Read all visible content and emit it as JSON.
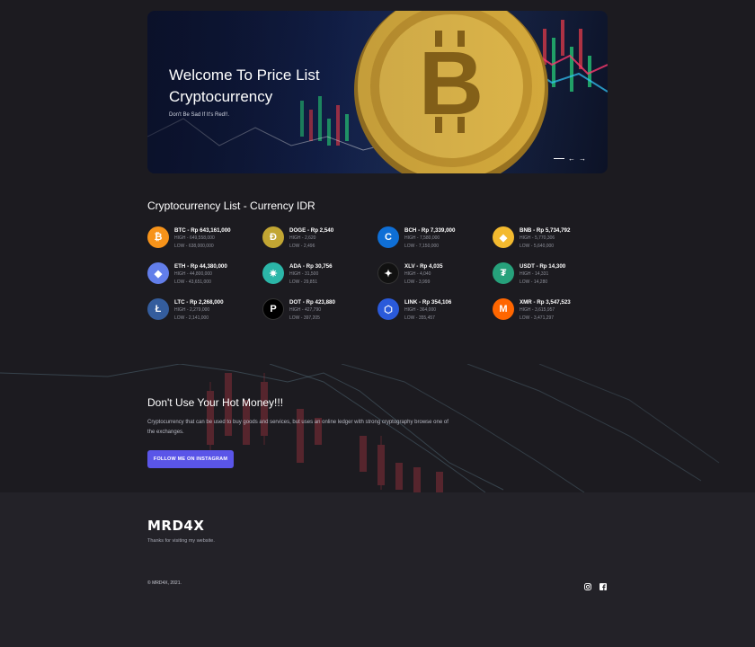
{
  "hero": {
    "title_line1": "Welcome To Price List",
    "title_line2": "Cryptocurrency",
    "subtitle": "Don't Be Sad If It's Red!!.",
    "nav_prev": "←",
    "nav_next": "→"
  },
  "list": {
    "title": "Cryptocurrency List - Currency IDR",
    "coins": [
      {
        "name": "BTC - Rp 643,161,000",
        "high": "HIGH - 649,558,000",
        "low": "LOW - 638,000,000",
        "color": "#f7931a",
        "icon": "bitcoin-icon",
        "glyph": "₿"
      },
      {
        "name": "DOGE - Rp 2,540",
        "high": "HIGH - 2,620",
        "low": "LOW - 2,496",
        "color": "#c2a633",
        "icon": "dogecoin-icon",
        "glyph": "Ð"
      },
      {
        "name": "BCH - Rp 7,339,000",
        "high": "HIGH - 7,580,000",
        "low": "LOW - 7,150,000",
        "color": "#0f6fd6",
        "icon": "bitcoin-cash-icon",
        "glyph": "C"
      },
      {
        "name": "BNB - Rp 5,734,792",
        "high": "HIGH - 5,770,306",
        "low": "LOW - 5,640,000",
        "color": "#f3ba2f",
        "icon": "binance-coin-icon",
        "glyph": "◆"
      },
      {
        "name": "ETH - Rp 44,380,000",
        "high": "HIGH - 44,800,000",
        "low": "LOW - 43,651,000",
        "color": "#627eea",
        "icon": "ethereum-icon",
        "glyph": "◆"
      },
      {
        "name": "ADA - Rp 30,756",
        "high": "HIGH - 31,500",
        "low": "LOW - 29,851",
        "color": "#2bb6a8",
        "icon": "cardano-icon",
        "glyph": "✷"
      },
      {
        "name": "XLV - Rp 4,035",
        "high": "HIGH - 4,040",
        "low": "LOW - 3,999",
        "color": "#111111",
        "icon": "stellar-icon",
        "glyph": "✦"
      },
      {
        "name": "USDT - Rp 14,300",
        "high": "HIGH - 14,331",
        "low": "LOW - 14,280",
        "color": "#26a17b",
        "icon": "tether-icon",
        "glyph": "₮"
      },
      {
        "name": "LTC - Rp 2,268,000",
        "high": "HIGH - 2,279,000",
        "low": "LOW - 2,141,000",
        "color": "#345d9d",
        "icon": "litecoin-icon",
        "glyph": "Ł"
      },
      {
        "name": "DOT - Rp 423,880",
        "high": "HIGH - 427,790",
        "low": "LOW - 397,205",
        "color": "#000000",
        "icon": "polkadot-icon",
        "glyph": "P"
      },
      {
        "name": "LINK - Rp 354,106",
        "high": "HIGH - 364,000",
        "low": "LOW - 355,457",
        "color": "#2a5ada",
        "icon": "chainlink-icon",
        "glyph": "⬡"
      },
      {
        "name": "XMR - Rp 3,547,523",
        "high": "HIGH - 3,615,957",
        "low": "LOW - 3,471,297",
        "color": "#ff6600",
        "icon": "monero-icon",
        "glyph": "M"
      }
    ]
  },
  "promo": {
    "title": "Don't Use Your Hot Money!!!",
    "text": "Cryptocurrency that can be used to buy goods and services, but uses an online ledger with strong cryptography browse one of the exchanges.",
    "button": "FOLLOW ME ON INSTAGRAM",
    "accent": "#5a55e8"
  },
  "footer": {
    "logo": "MRD4X",
    "subtitle": "Thanks for visiting my website.",
    "copyright": "© MRD4X, 2021.",
    "social": [
      "instagram-icon",
      "facebook-icon"
    ]
  }
}
